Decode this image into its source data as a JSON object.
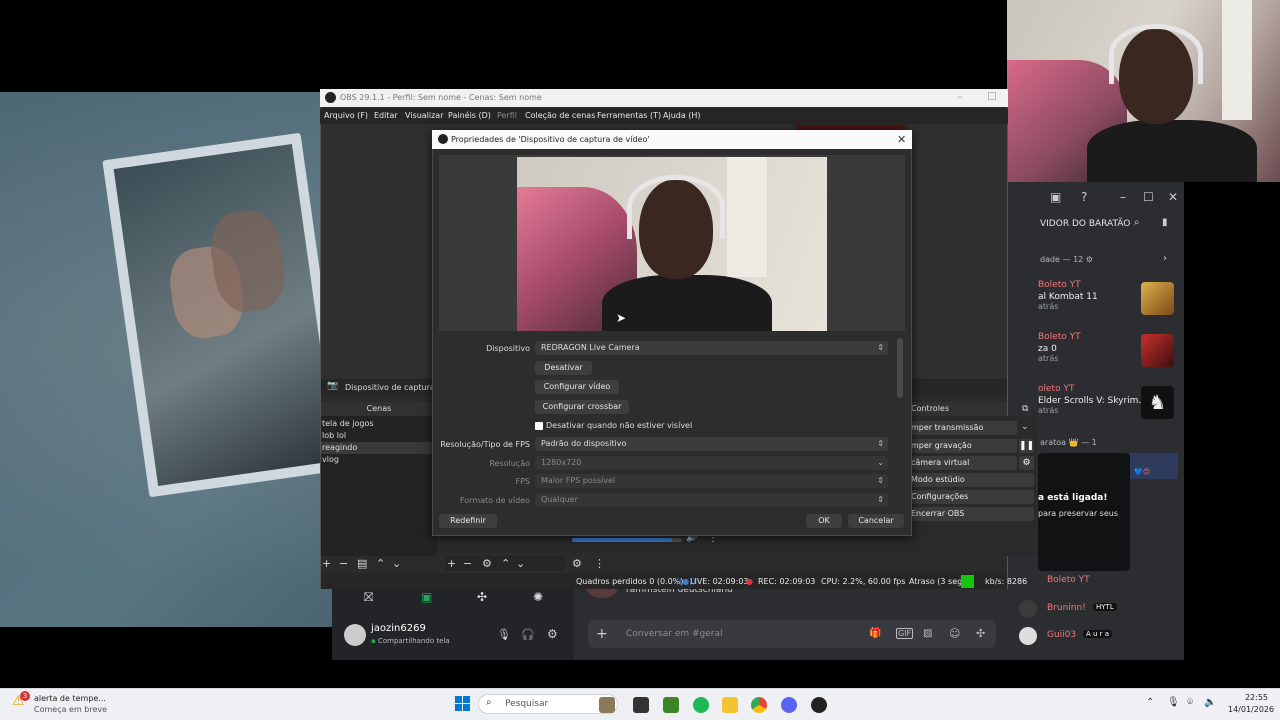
{
  "colors": {
    "obs_bg": "#2b2b2b",
    "discord_bg": "#2b2d31",
    "accent_red": "#f2757a",
    "rec_dot": "#e0303f",
    "green_status": "#16c60c"
  },
  "obs": {
    "title": "OBS 29.1.1 - Perfil: Sem nome - Cenas: Sem nome",
    "menus": [
      "Arquivo (F)",
      "Editar",
      "Visualizar",
      "Painéis (D)",
      "Perfil",
      "Coleção de cenas",
      "Ferramentas (T)",
      "Ajuda (H)"
    ],
    "source_label": "Dispositivo de captura de",
    "scenes_title": "Cenas",
    "scenes": [
      "tela de jogos",
      "lob lol",
      "reagindo",
      "vlog"
    ],
    "controls_title": "Controles",
    "controls": [
      "mper transmissão",
      "mper gravação",
      "câmera virtual",
      "Modo estúdio",
      "Configurações",
      "Encerrar OBS"
    ],
    "status": {
      "dropped": "Quadros perdidos 0 (0.0%)",
      "live": "LIVE: 02:09:03",
      "rec": "REC: 02:09:03",
      "cpu": "CPU: 2.2%, 60.00 fps",
      "delay": "Atraso (3 seg)",
      "kbs": "kb/s: 8286"
    }
  },
  "dialog": {
    "title": "Propriedades de 'Dispositivo de captura de vídeo'",
    "device_label": "Dispositivo",
    "device_value": "REDRAGON  Live Camera",
    "btn_disable": "Desativar",
    "btn_config_video": "Configurar vídeo",
    "btn_config_crossbar": "Configurar crossbar",
    "checkbox_label": "Desativar quando não estiver visível",
    "res_type_label": "Resolução/Tipo de FPS",
    "res_type_value": "Padrão do dispositivo",
    "resolution_label": "Resolução",
    "resolution_value": "1280x720",
    "fps_label": "FPS",
    "fps_value": "Maior FPS possível",
    "format_label": "Formato de vídeo",
    "format_value": "Qualquer",
    "btn_reset": "Redefinir",
    "btn_ok": "OK",
    "btn_cancel": "Cancelar"
  },
  "discord": {
    "server_name": "VIDOR DO BARATÃO",
    "activity_header": "dade — 12",
    "activities": [
      {
        "user": "Boleto YT",
        "game": "al Kombat 11",
        "time": "atrás"
      },
      {
        "user": "Boleto YT",
        "game": "za 0",
        "time": "atrás"
      },
      {
        "user": "oleto YT",
        "game": "Elder Scrolls V: Skyrim...",
        "time": "atrás"
      }
    ],
    "live_section": "aratoa 👑 — 1",
    "live_text": "a está ligada!",
    "live_sub": "para preservar seus",
    "members": [
      "Boleto YT",
      "Bruninn!",
      "Guii03"
    ],
    "member_tags": [
      "",
      "HYTL",
      "A u r a"
    ],
    "music_text": "rammstein deutschland",
    "username": "jaozin6269",
    "user_status": "Compartilhando tela",
    "chat_placeholder": "Conversar em #geral"
  },
  "taskbar": {
    "notification_title": "alerta de tempe...",
    "notification_sub": "Começa em breve",
    "notification_badge": "3",
    "search_placeholder": "Pesquisar",
    "time": "22:55",
    "date": "14/01/2026"
  }
}
